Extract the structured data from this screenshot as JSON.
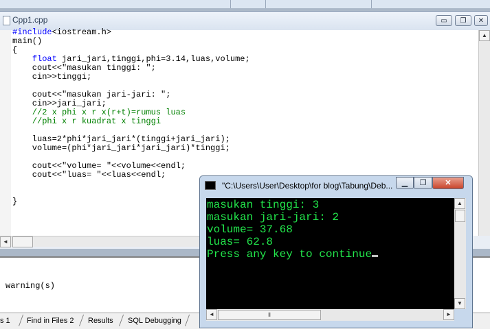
{
  "editor": {
    "title": "Cpp1.cpp",
    "buttons": {
      "minimize": "▭",
      "restore": "❐",
      "close": "✕"
    },
    "code_lines": [
      {
        "parts": [
          {
            "t": "#include",
            "c": "kw"
          },
          {
            "t": "<iostream.h>",
            "c": ""
          }
        ]
      },
      {
        "parts": [
          {
            "t": "main()",
            "c": ""
          }
        ]
      },
      {
        "parts": [
          {
            "t": "{",
            "c": ""
          }
        ]
      },
      {
        "parts": [
          {
            "t": "    ",
            "c": ""
          },
          {
            "t": "float",
            "c": "kw"
          },
          {
            "t": " jari_jari,tinggi,phi=3.14,luas,volume;",
            "c": ""
          }
        ]
      },
      {
        "parts": [
          {
            "t": "    cout<<\"masukan tinggi: \";",
            "c": ""
          }
        ]
      },
      {
        "parts": [
          {
            "t": "    cin>>tinggi;",
            "c": ""
          }
        ]
      },
      {
        "parts": [
          {
            "t": "",
            "c": ""
          }
        ]
      },
      {
        "parts": [
          {
            "t": "    cout<<\"masukan jari-jari: \";",
            "c": ""
          }
        ]
      },
      {
        "parts": [
          {
            "t": "    cin>>jari_jari;",
            "c": ""
          }
        ]
      },
      {
        "parts": [
          {
            "t": "    //2 x phi x r x(r+t)=rumus luas",
            "c": "cm"
          }
        ]
      },
      {
        "parts": [
          {
            "t": "    //phi x r kuadrat x tinggi",
            "c": "cm"
          }
        ]
      },
      {
        "parts": [
          {
            "t": "",
            "c": ""
          }
        ]
      },
      {
        "parts": [
          {
            "t": "    luas=2*phi*jari_jari*(tinggi+jari_jari);",
            "c": ""
          }
        ]
      },
      {
        "parts": [
          {
            "t": "    volume=(phi*jari_jari*jari_jari)*tinggi;",
            "c": ""
          }
        ]
      },
      {
        "parts": [
          {
            "t": "",
            "c": ""
          }
        ]
      },
      {
        "parts": [
          {
            "t": "    cout<<\"volume= \"<<volume<<endl;",
            "c": ""
          }
        ]
      },
      {
        "parts": [
          {
            "t": "    cout<<\"luas= \"<<luas<<endl;",
            "c": ""
          }
        ]
      },
      {
        "parts": [
          {
            "t": "",
            "c": ""
          }
        ]
      },
      {
        "parts": [
          {
            "t": "",
            "c": ""
          }
        ]
      },
      {
        "parts": [
          {
            "t": "}",
            "c": ""
          }
        ]
      }
    ]
  },
  "output": {
    "text": "warning(s)"
  },
  "tabs": [
    "s 1",
    "Find in Files 2",
    "Results",
    "SQL Debugging"
  ],
  "console": {
    "title": "\"C:\\Users\\User\\Desktop\\for blog\\Tabung\\Deb...",
    "buttons": {
      "minimize": "▁",
      "restore": "❐",
      "close": "✕"
    },
    "lines": [
      "masukan tinggi: 3",
      "masukan jari-jari: 2",
      "volume= 37.68",
      "luas= 62.8",
      "Press any key to continue"
    ],
    "scroll": {
      "up": "▲",
      "down": "▼",
      "left": "◄",
      "right": "►",
      "grip": "⦀"
    }
  },
  "colors": {
    "console_text": "#22e64b",
    "keyword": "#0000ff",
    "comment": "#008000"
  }
}
